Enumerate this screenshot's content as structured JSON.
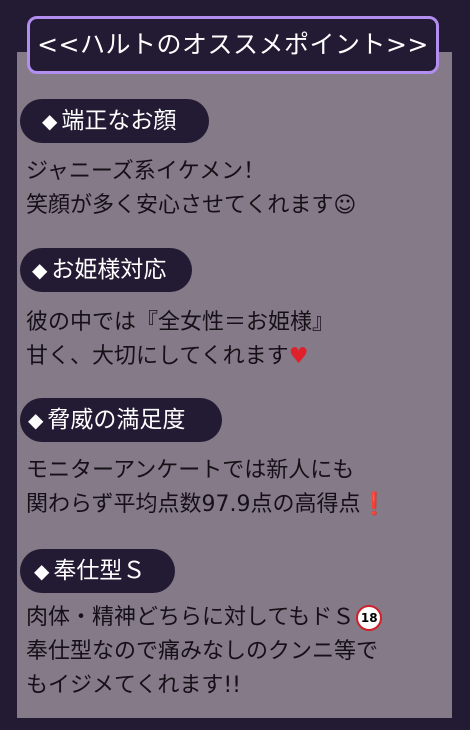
{
  "title": "<<ハルトのオススメポイント>>",
  "sections": [
    {
      "heading_symbol": "◆",
      "heading": "端正なお顔",
      "lines": [
        "ジャニーズ系イケメン！",
        "笑顔が多く安心させてくれます☺"
      ]
    },
    {
      "heading_symbol": "◆",
      "heading": "お姫様対応",
      "lines": [
        "彼の中では『全女性＝お姫様』",
        "甘く、大切にしてくれます"
      ],
      "line2_emoji": "♥"
    },
    {
      "heading_symbol": "◆",
      "heading": "脅威の満足度",
      "lines": [
        "モニターアンケートでは新人にも",
        "関わらず平均点数97.9点の高得点"
      ],
      "line2_emoji": "❗"
    },
    {
      "heading_symbol": "◆",
      "heading": "奉仕型Ｓ",
      "lines": [
        "肉体・精神どちらに対してもドＳ",
        "奉仕型なので痛みなしのクンニ等で",
        "もイジメてくれます!!"
      ],
      "line1_badge": "18"
    }
  ],
  "colors": {
    "background": "#231b33",
    "panel": "#857a88",
    "title_border": "#b28ef0",
    "accent_red": "#e0202a"
  }
}
